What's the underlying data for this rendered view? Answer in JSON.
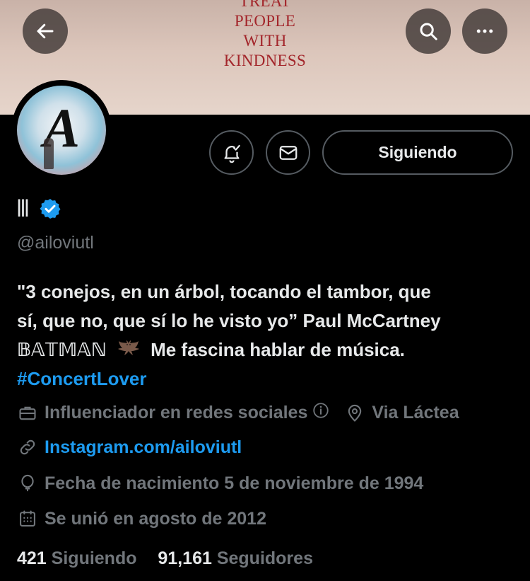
{
  "banner": {
    "lines": [
      "TREAT",
      "PEOPLE",
      "WITH",
      "KINDNESS"
    ],
    "text_color": "#a3262b"
  },
  "header": {
    "back_icon": "back-arrow-icon",
    "search_icon": "search-icon",
    "more_icon": "more-icon"
  },
  "profile": {
    "avatar_letter": "A",
    "name": "𝍫",
    "verified": true,
    "verified_color": "#1d9bf0",
    "handle": "@ailoviutl",
    "following_button_label": "Siguiendo",
    "bio_line1": "\"3 conejos, en un árbol, tocando el tambor, que",
    "bio_line2": "sí, que no, que sí lo he visto yo” Paul McCartney",
    "bio_batman": "𝔹𝔸𝕋𝕄𝔸ℕ",
    "bio_line3_rest": "Me fascina hablar de música.",
    "hashtag": "#ConcertLover",
    "category": "Influenciador en redes sociales",
    "location": "Via Láctea",
    "website": "Instagram.com/ailoviutl",
    "birthday": "Fecha de nacimiento 5 de noviembre de 1994",
    "joined": "Se unió en agosto de 2012",
    "following_count": "421",
    "following_label": "Siguiendo",
    "followers_count": "91,161",
    "followers_label": "Seguidores"
  },
  "colors": {
    "background": "#000000",
    "text": "#e7e9ea",
    "muted": "#71767b",
    "accent": "#1d9bf0"
  }
}
